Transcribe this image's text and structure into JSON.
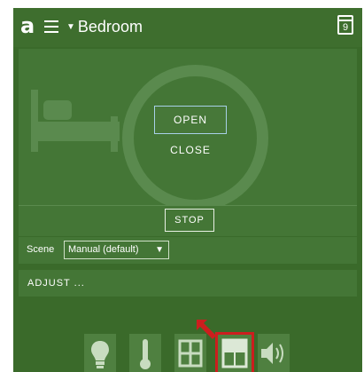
{
  "app": {
    "logo_text": "a",
    "room": "Bedroom",
    "calendar_day": "9"
  },
  "shade_control": {
    "open_label": "OPEN",
    "close_label": "CLOSE",
    "stop_label": "STOP"
  },
  "scene": {
    "label": "Scene",
    "selected": "Manual (default)"
  },
  "adjust_label": "ADJUST ...",
  "bottom_tabs": [
    {
      "icon": "light-bulb-icon"
    },
    {
      "icon": "thermometer-icon"
    },
    {
      "icon": "window-icon"
    },
    {
      "icon": "shade-icon",
      "selected": true
    },
    {
      "icon": "speaker-icon"
    }
  ],
  "colors": {
    "background": "#3a6a2a",
    "panel": "#447636",
    "highlight": "#cc1e1e"
  }
}
